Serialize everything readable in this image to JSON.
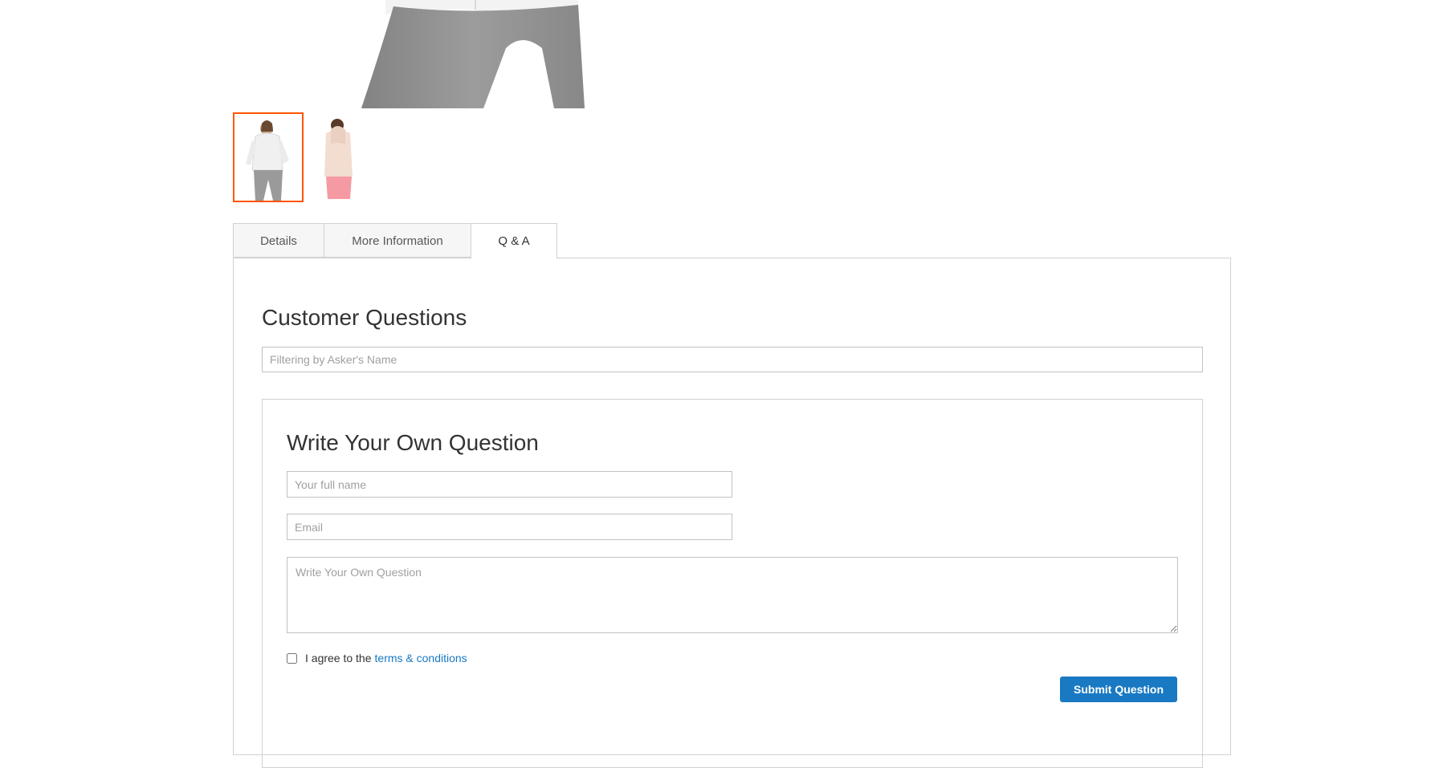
{
  "gallery": {
    "main_image_icon": "hoodie-front-image",
    "thumbnails": [
      {
        "icon": "hoodie-white-front-thumbnail",
        "active": true
      },
      {
        "icon": "hoodie-pink-back-thumbnail",
        "active": false
      }
    ],
    "active_border_color": "#ff5501"
  },
  "tabs": [
    {
      "label": "Details",
      "active": false
    },
    {
      "label": "More Information",
      "active": false
    },
    {
      "label": "Q & A",
      "active": true
    }
  ],
  "qa": {
    "title": "Customer Questions",
    "filter_placeholder": "Filtering by Asker's Name",
    "form": {
      "title": "Write Your Own Question",
      "name_placeholder": "Your full name",
      "email_placeholder": "Email",
      "question_placeholder": "Write Your Own Question",
      "agree_text": "I agree to the",
      "terms_link": "terms & conditions",
      "submit_label": "Submit Question"
    }
  },
  "colors": {
    "link": "#1979c3",
    "button": "#1979c3",
    "border": "#d1d1d1"
  }
}
